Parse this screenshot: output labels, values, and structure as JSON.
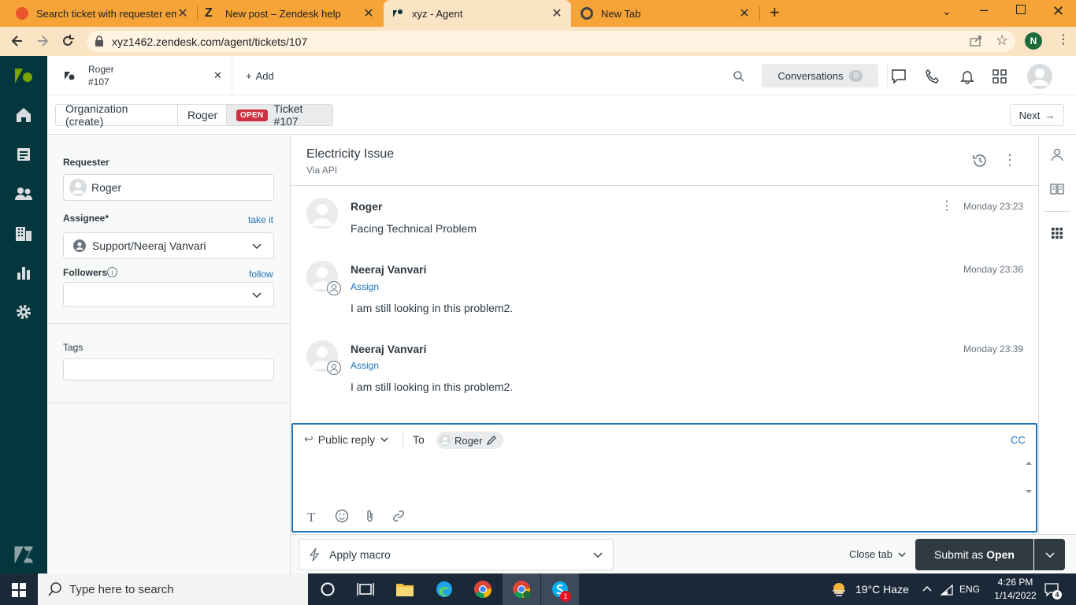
{
  "browser": {
    "tabs": [
      {
        "title": "Search ticket with requester ema",
        "active": false
      },
      {
        "title": "New post – Zendesk help",
        "active": false
      },
      {
        "title": "xyz - Agent",
        "active": true
      },
      {
        "title": "New Tab",
        "active": false
      }
    ],
    "url": "xyz1462.zendesk.com/agent/tickets/107",
    "profile_initial": "N"
  },
  "header": {
    "tab_title": "Roger",
    "tab_subtitle": "#107",
    "add_label": "Add",
    "conversations_label": "Conversations",
    "conversations_count": "0"
  },
  "breadcrumbs": {
    "organization": "Organization (create)",
    "requester": "Roger",
    "status_badge": "OPEN",
    "ticket": "Ticket #107",
    "next": "Next"
  },
  "sidebar": {
    "requester_label": "Requester",
    "requester_value": "Roger",
    "assignee_label": "Assignee*",
    "take_it": "take it",
    "assignee_value": "Support/Neeraj Vanvari",
    "followers_label": "Followers",
    "follow": "follow",
    "tags_label": "Tags"
  },
  "ticket": {
    "subject": "Electricity Issue",
    "via": "Via API",
    "messages": [
      {
        "author": "Roger",
        "time": "Monday 23:23",
        "body": "Facing Technical Problem",
        "assign": ""
      },
      {
        "author": "Neeraj Vanvari",
        "time": "Monday 23:36",
        "body": "I am still looking in this problem2.",
        "assign": "Assign"
      },
      {
        "author": "Neeraj Vanvari",
        "time": "Monday 23:39",
        "body": "I am still looking in this problem2.",
        "assign": "Assign"
      }
    ]
  },
  "composer": {
    "reply_type": "Public reply",
    "to_label": "To",
    "recipient": "Roger",
    "cc": "CC"
  },
  "footer": {
    "macro": "Apply macro",
    "close_tab": "Close tab",
    "submit_prefix": "Submit as",
    "submit_status": "Open"
  },
  "taskbar": {
    "search_placeholder": "Type here to search",
    "weather": "19°C  Haze",
    "lang": "ENG",
    "time": "4:26 PM",
    "date": "1/14/2022",
    "notif_count": "4",
    "skype_badge": "1"
  },
  "colors": {
    "browser_tab_bar": "#f6a437",
    "zendesk_nav": "#03363d",
    "link_blue": "#1f73b7",
    "open_badge": "#cc3340",
    "submit_button": "#2f3941"
  }
}
